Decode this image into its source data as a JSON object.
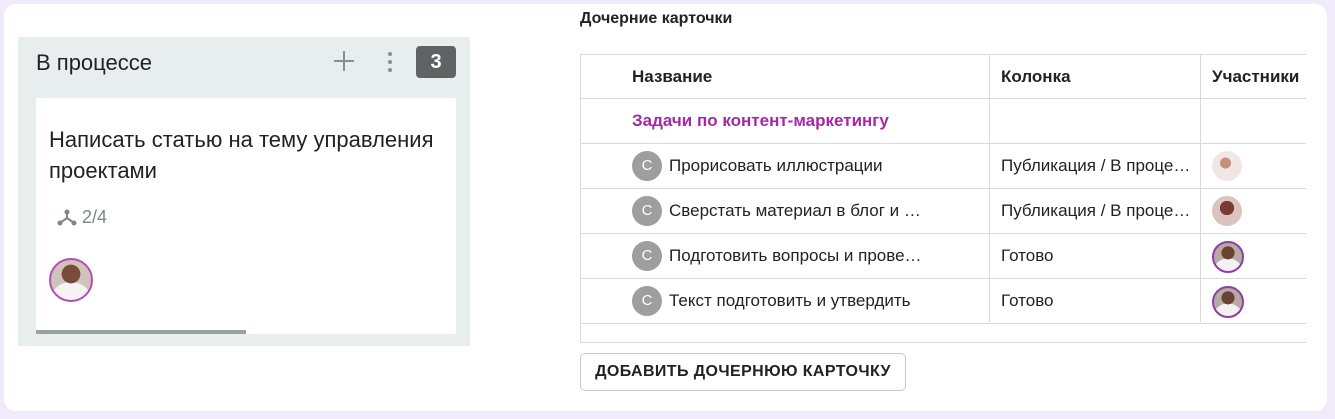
{
  "column": {
    "title": "В процессе",
    "count": "3",
    "add_icon": "plus-icon",
    "menu_icon": "more-vertical-icon"
  },
  "card": {
    "title": "Написать статью на тему управления проектами",
    "subtasks": "2/4",
    "subtasks_icon": "subtasks-icon",
    "progress_fraction": 0.5
  },
  "child_cards": {
    "section_title": "Дочерние карточки",
    "headers": {
      "name": "Название",
      "column": "Колонка",
      "participants": "Участники"
    },
    "group": "Задачи по контент-маркетингу",
    "rows": [
      {
        "badge": "С",
        "name": "Прорисовать иллюстрации",
        "column": "Публикация / В процессе"
      },
      {
        "badge": "С",
        "name": "Сверстать материал в блог и …",
        "column": "Публикация / В процессе"
      },
      {
        "badge": "С",
        "name": "Подготовить вопросы и прове…",
        "column": "Готово"
      },
      {
        "badge": "С",
        "name": "Текст подготовить и утвердить",
        "column": "Готово"
      }
    ],
    "add_button": "ДОБАВИТЬ ДОЧЕРНЮЮ КАРТОЧКУ"
  },
  "colors": {
    "accent": "#a32aa3",
    "count_badge": "#5f6363",
    "column_bg": "#e8eded"
  }
}
